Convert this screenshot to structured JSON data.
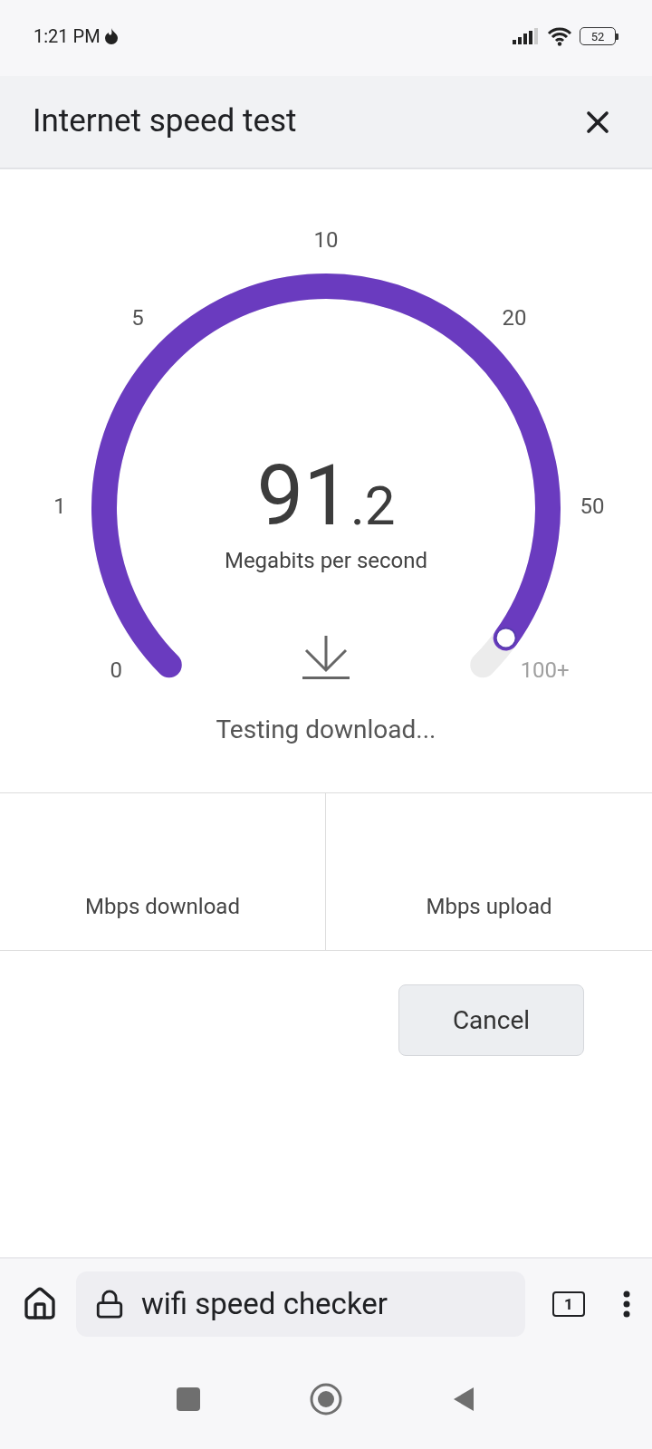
{
  "status_bar": {
    "time": "1:21 PM",
    "battery": "52"
  },
  "header": {
    "title": "Internet speed test"
  },
  "gauge": {
    "labels": [
      "0",
      "1",
      "5",
      "10",
      "20",
      "50",
      "100+"
    ],
    "value_integer": "91",
    "value_decimal": ".2",
    "unit": "Megabits per second",
    "status": "Testing download..."
  },
  "results": [
    {
      "label": "Mbps download"
    },
    {
      "label": "Mbps upload"
    }
  ],
  "cancel_button": "Cancel",
  "browser_bar": {
    "url": "wifi speed checker",
    "tab_count": "1"
  }
}
